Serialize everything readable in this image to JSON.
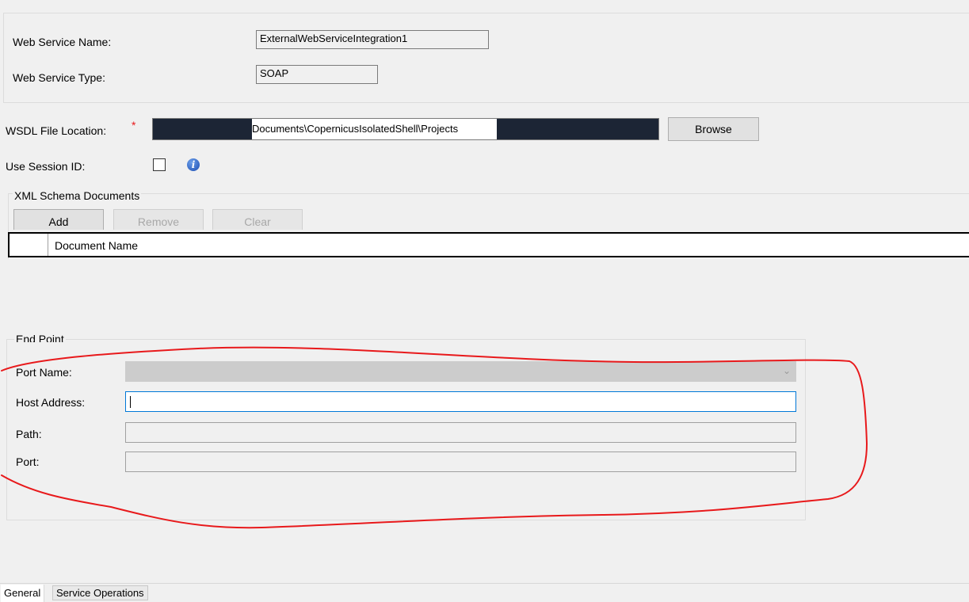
{
  "general": {
    "web_service_name_label": "Web Service Name:",
    "web_service_name_value": "ExternalWebServiceIntegration1",
    "web_service_type_label": "Web Service Type:",
    "web_service_type_value": "SOAP"
  },
  "wsdl": {
    "label": "WSDL File Location:",
    "required_marker": "*",
    "value_visible": "Documents\\CopernicusIsolatedShell\\Projects",
    "browse_label": "Browse"
  },
  "session": {
    "label": "Use Session ID:",
    "checked": false,
    "info_icon": "info-icon"
  },
  "xml_schema": {
    "caption": "XML Schema Documents",
    "add_label": "Add",
    "remove_label": "Remove",
    "clear_label": "Clear",
    "column_header": "Document Name"
  },
  "end_point": {
    "caption": "End Point",
    "port_name_label": "Port Name:",
    "host_address_label": "Host Address:",
    "path_label": "Path:",
    "port_label": "Port:"
  },
  "tabs": [
    {
      "label": "General",
      "active": true
    },
    {
      "label": "Service Operations",
      "active": false
    }
  ],
  "colors": {
    "annotation": "#e8191b",
    "redaction": "#1c2535",
    "focus_border": "#0078d7"
  }
}
